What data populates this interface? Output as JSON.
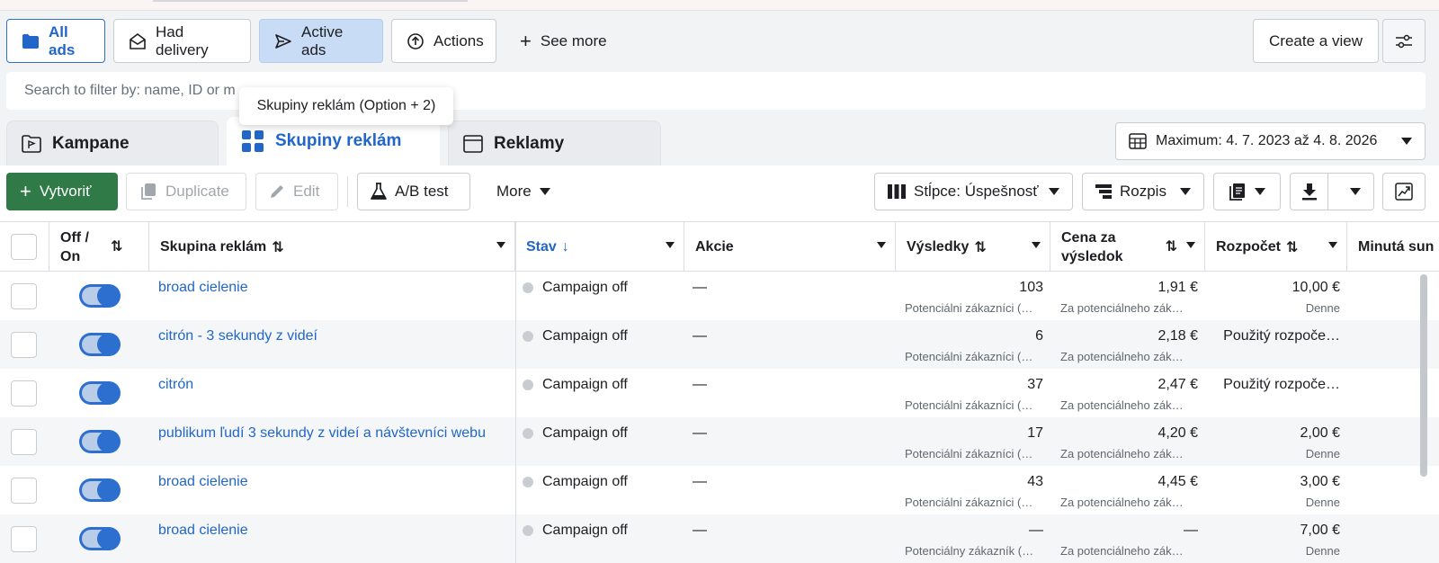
{
  "views": {
    "all_ads": "All ads",
    "had_delivery": "Had delivery",
    "active_ads": "Active ads",
    "actions": "Actions",
    "see_more": "See more",
    "create_view": "Create a view"
  },
  "search": {
    "placeholder": "Search to filter by: name, ID or m"
  },
  "tooltip": "Skupiny reklám (Option + 2)",
  "tabs": {
    "kampane": "Kampane",
    "skupiny": "Skupiny reklám",
    "reklamy": "Reklamy"
  },
  "date_range": "Maximum: 4. 7. 2023 až 4. 8. 2026",
  "toolbar": {
    "create": "Vytvoriť",
    "duplicate": "Duplicate",
    "edit": "Edit",
    "ab_test": "A/B test",
    "more": "More",
    "columns": "Stĺpce: Úspešnosť",
    "breakdown": "Rozpis"
  },
  "headers": {
    "off_on": "Off / On",
    "ad_set": "Skupina reklám",
    "status": "Stav",
    "actions": "Akcie",
    "results": "Výsledky",
    "cost": "Cena za výsledok",
    "budget": "Rozpočet",
    "spent": "Minutá sun"
  },
  "rows": [
    {
      "name": "broad cielenie",
      "status": "Campaign off",
      "akcie": "—",
      "results": "103",
      "results_sub": "Potenciálni zákazníci (…",
      "cost": "1,91 €",
      "cost_sub": "Za potenciálneho zák…",
      "budget": "10,00 €",
      "budget_sub": "Denne"
    },
    {
      "name": "citrón - 3 sekundy z videí",
      "status": "Campaign off",
      "akcie": "—",
      "results": "6",
      "results_sub": "Potenciálni zákazníci (…",
      "cost": "2,18 €",
      "cost_sub": "Za potenciálneho zák…",
      "budget": "Použitý rozpoče…",
      "budget_sub": ""
    },
    {
      "name": "citrón",
      "status": "Campaign off",
      "akcie": "—",
      "results": "37",
      "results_sub": "Potenciálni zákazníci (…",
      "cost": "2,47 €",
      "cost_sub": "Za potenciálneho zák…",
      "budget": "Použitý rozpoče…",
      "budget_sub": ""
    },
    {
      "name": "publikum ľudí 3 sekundy z videí a návštevníci webu",
      "status": "Campaign off",
      "akcie": "—",
      "results": "17",
      "results_sub": "Potenciálni zákazníci (…",
      "cost": "4,20 €",
      "cost_sub": "Za potenciálneho zák…",
      "budget": "2,00 €",
      "budget_sub": "Denne"
    },
    {
      "name": "broad cielenie",
      "status": "Campaign off",
      "akcie": "—",
      "results": "43",
      "results_sub": "Potenciálni zákazníci (…",
      "cost": "4,45 €",
      "cost_sub": "Za potenciálneho zák…",
      "budget": "3,00 €",
      "budget_sub": "Denne"
    },
    {
      "name": "broad cielenie",
      "status": "Campaign off",
      "akcie": "—",
      "results": "—",
      "results_sub": "Potenciálny zákazník (…",
      "cost": "—",
      "cost_sub": "Za potenciálneho zák…",
      "budget": "7,00 €",
      "budget_sub": "Denne"
    }
  ]
}
